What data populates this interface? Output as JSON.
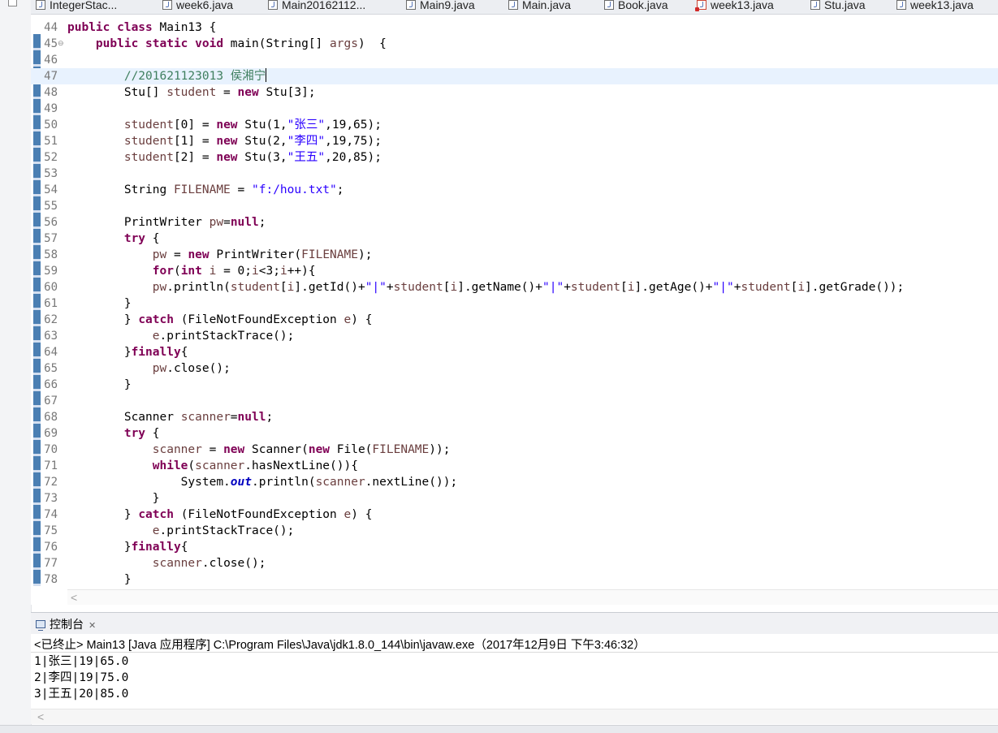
{
  "editor_tabs": [
    {
      "label": "IntegerStac...",
      "icon": "java-file-icon"
    },
    {
      "label": "week6.java",
      "icon": "java-file-icon"
    },
    {
      "label": "Main20162112...",
      "icon": "java-file-icon"
    },
    {
      "label": "Main9.java",
      "icon": "java-file-icon"
    },
    {
      "label": "Main.java",
      "icon": "java-file-icon"
    },
    {
      "label": "Book.java",
      "icon": "java-file-icon"
    },
    {
      "label": "week13.java",
      "icon": "java-file-error-icon"
    },
    {
      "label": "Stu.java",
      "icon": "java-file-icon"
    },
    {
      "label": "week13.java",
      "icon": "java-file-icon"
    }
  ],
  "editor": {
    "current_line": 47,
    "lines": [
      {
        "n": "44",
        "t": [
          [
            "kw",
            "public "
          ],
          [
            "kw",
            "class "
          ],
          [
            "",
            "Main13 {"
          ]
        ]
      },
      {
        "n": "45",
        "fold": "⊖",
        "t": [
          [
            "",
            "    "
          ],
          [
            "kw",
            "public "
          ],
          [
            "kw",
            "static "
          ],
          [
            "kw",
            "void "
          ],
          [
            "",
            "main(String[] "
          ],
          [
            "var",
            "args"
          ],
          [
            "",
            ")  {"
          ]
        ]
      },
      {
        "n": "46",
        "t": []
      },
      {
        "n": "47",
        "t": [
          [
            "",
            "        "
          ],
          [
            "cmt",
            "//201621123013 侯湘宁"
          ]
        ],
        "caret": true
      },
      {
        "n": "48",
        "t": [
          [
            "",
            "        Stu[] "
          ],
          [
            "var",
            "student"
          ],
          [
            "",
            " = "
          ],
          [
            "kw",
            "new "
          ],
          [
            "",
            "Stu[3];"
          ]
        ]
      },
      {
        "n": "49",
        "t": []
      },
      {
        "n": "50",
        "t": [
          [
            "",
            "        "
          ],
          [
            "var",
            "student"
          ],
          [
            "",
            "[0] = "
          ],
          [
            "kw",
            "new "
          ],
          [
            "",
            "Stu(1,"
          ],
          [
            "str",
            "\"张三\""
          ],
          [
            "",
            ",19,65);"
          ]
        ]
      },
      {
        "n": "51",
        "t": [
          [
            "",
            "        "
          ],
          [
            "var",
            "student"
          ],
          [
            "",
            "[1] = "
          ],
          [
            "kw",
            "new "
          ],
          [
            "",
            "Stu(2,"
          ],
          [
            "str",
            "\"李四\""
          ],
          [
            "",
            ",19,75);"
          ]
        ]
      },
      {
        "n": "52",
        "t": [
          [
            "",
            "        "
          ],
          [
            "var",
            "student"
          ],
          [
            "",
            "[2] = "
          ],
          [
            "kw",
            "new "
          ],
          [
            "",
            "Stu(3,"
          ],
          [
            "str",
            "\"王五\""
          ],
          [
            "",
            ",20,85);"
          ]
        ]
      },
      {
        "n": "53",
        "t": []
      },
      {
        "n": "54",
        "t": [
          [
            "",
            "        String "
          ],
          [
            "var",
            "FILENAME"
          ],
          [
            "",
            " = "
          ],
          [
            "str",
            "\"f:/hou.txt\""
          ],
          [
            "",
            ";"
          ]
        ]
      },
      {
        "n": "55",
        "t": []
      },
      {
        "n": "56",
        "t": [
          [
            "",
            "        PrintWriter "
          ],
          [
            "var",
            "pw"
          ],
          [
            "",
            "="
          ],
          [
            "kw",
            "null"
          ],
          [
            "",
            ";"
          ]
        ]
      },
      {
        "n": "57",
        "t": [
          [
            "",
            "        "
          ],
          [
            "kw",
            "try "
          ],
          [
            "",
            "{"
          ]
        ]
      },
      {
        "n": "58",
        "t": [
          [
            "",
            "            "
          ],
          [
            "var",
            "pw"
          ],
          [
            "",
            " = "
          ],
          [
            "kw",
            "new "
          ],
          [
            "",
            "PrintWriter("
          ],
          [
            "var",
            "FILENAME"
          ],
          [
            "",
            ");"
          ]
        ]
      },
      {
        "n": "59",
        "t": [
          [
            "",
            "            "
          ],
          [
            "kw",
            "for"
          ],
          [
            "",
            "("
          ],
          [
            "kw",
            "int "
          ],
          [
            "var",
            "i"
          ],
          [
            "",
            " = 0;"
          ],
          [
            "var",
            "i"
          ],
          [
            "",
            "<3;"
          ],
          [
            "var",
            "i"
          ],
          [
            "",
            "++){"
          ]
        ]
      },
      {
        "n": "60",
        "t": [
          [
            "",
            "            "
          ],
          [
            "var",
            "pw"
          ],
          [
            "",
            ".println("
          ],
          [
            "var",
            "student"
          ],
          [
            "",
            "["
          ],
          [
            "var",
            "i"
          ],
          [
            "",
            "].getId()+"
          ],
          [
            "str",
            "\"|\""
          ],
          [
            "",
            "+"
          ],
          [
            "var",
            "student"
          ],
          [
            "",
            "["
          ],
          [
            "var",
            "i"
          ],
          [
            "",
            "].getName()+"
          ],
          [
            "str",
            "\"|\""
          ],
          [
            "",
            "+"
          ],
          [
            "var",
            "student"
          ],
          [
            "",
            "["
          ],
          [
            "var",
            "i"
          ],
          [
            "",
            "].getAge()+"
          ],
          [
            "str",
            "\"|\""
          ],
          [
            "",
            "+"
          ],
          [
            "var",
            "student"
          ],
          [
            "",
            "["
          ],
          [
            "var",
            "i"
          ],
          [
            "",
            "].getGrade());"
          ]
        ]
      },
      {
        "n": "61",
        "t": [
          [
            "",
            "        }"
          ]
        ]
      },
      {
        "n": "62",
        "t": [
          [
            "",
            "        } "
          ],
          [
            "kw",
            "catch "
          ],
          [
            "",
            "(FileNotFoundException "
          ],
          [
            "var",
            "e"
          ],
          [
            "",
            ") {"
          ]
        ]
      },
      {
        "n": "63",
        "t": [
          [
            "",
            "            "
          ],
          [
            "var",
            "e"
          ],
          [
            "",
            ".printStackTrace();"
          ]
        ]
      },
      {
        "n": "64",
        "t": [
          [
            "",
            "        }"
          ],
          [
            "kw",
            "finally"
          ],
          [
            "",
            "{"
          ]
        ]
      },
      {
        "n": "65",
        "t": [
          [
            "",
            "            "
          ],
          [
            "var",
            "pw"
          ],
          [
            "",
            ".close();"
          ]
        ]
      },
      {
        "n": "66",
        "t": [
          [
            "",
            "        }"
          ]
        ]
      },
      {
        "n": "67",
        "t": []
      },
      {
        "n": "68",
        "t": [
          [
            "",
            "        Scanner "
          ],
          [
            "var",
            "scanner"
          ],
          [
            "",
            "="
          ],
          [
            "kw",
            "null"
          ],
          [
            "",
            ";"
          ]
        ]
      },
      {
        "n": "69",
        "t": [
          [
            "",
            "        "
          ],
          [
            "kw",
            "try "
          ],
          [
            "",
            "{"
          ]
        ]
      },
      {
        "n": "70",
        "t": [
          [
            "",
            "            "
          ],
          [
            "var",
            "scanner"
          ],
          [
            "",
            " = "
          ],
          [
            "kw",
            "new "
          ],
          [
            "",
            "Scanner("
          ],
          [
            "kw",
            "new "
          ],
          [
            "",
            "File("
          ],
          [
            "var",
            "FILENAME"
          ],
          [
            "",
            "));"
          ]
        ]
      },
      {
        "n": "71",
        "t": [
          [
            "",
            "            "
          ],
          [
            "kw",
            "while"
          ],
          [
            "",
            "("
          ],
          [
            "var",
            "scanner"
          ],
          [
            "",
            ".hasNextLine()){"
          ]
        ]
      },
      {
        "n": "72",
        "t": [
          [
            "",
            "                System."
          ],
          [
            "sfld",
            "out"
          ],
          [
            "",
            ".println("
          ],
          [
            "var",
            "scanner"
          ],
          [
            "",
            ".nextLine());"
          ]
        ]
      },
      {
        "n": "73",
        "t": [
          [
            "",
            "            }"
          ]
        ]
      },
      {
        "n": "74",
        "t": [
          [
            "",
            "        } "
          ],
          [
            "kw",
            "catch "
          ],
          [
            "",
            "(FileNotFoundException "
          ],
          [
            "var",
            "e"
          ],
          [
            "",
            ") {"
          ]
        ]
      },
      {
        "n": "75",
        "t": [
          [
            "",
            "            "
          ],
          [
            "var",
            "e"
          ],
          [
            "",
            ".printStackTrace();"
          ]
        ]
      },
      {
        "n": "76",
        "t": [
          [
            "",
            "        }"
          ],
          [
            "kw",
            "finally"
          ],
          [
            "",
            "{"
          ]
        ]
      },
      {
        "n": "77",
        "t": [
          [
            "",
            "            "
          ],
          [
            "var",
            "scanner"
          ],
          [
            "",
            ".close();"
          ]
        ]
      },
      {
        "n": "78",
        "t": [
          [
            "",
            "        }"
          ]
        ]
      }
    ],
    "scroll_left_glyph": "<"
  },
  "console": {
    "tab_label": "控制台",
    "tab_close": "✕",
    "header": "<已终止> Main13 [Java 应用程序] C:\\Program Files\\Java\\jdk1.8.0_144\\bin\\javaw.exe（2017年12月9日 下午3:46:32）",
    "output": [
      "1|张三|19|65.0",
      "2|李四|19|75.0",
      "3|王五|20|85.0"
    ],
    "scroll_left_glyph": "<"
  }
}
